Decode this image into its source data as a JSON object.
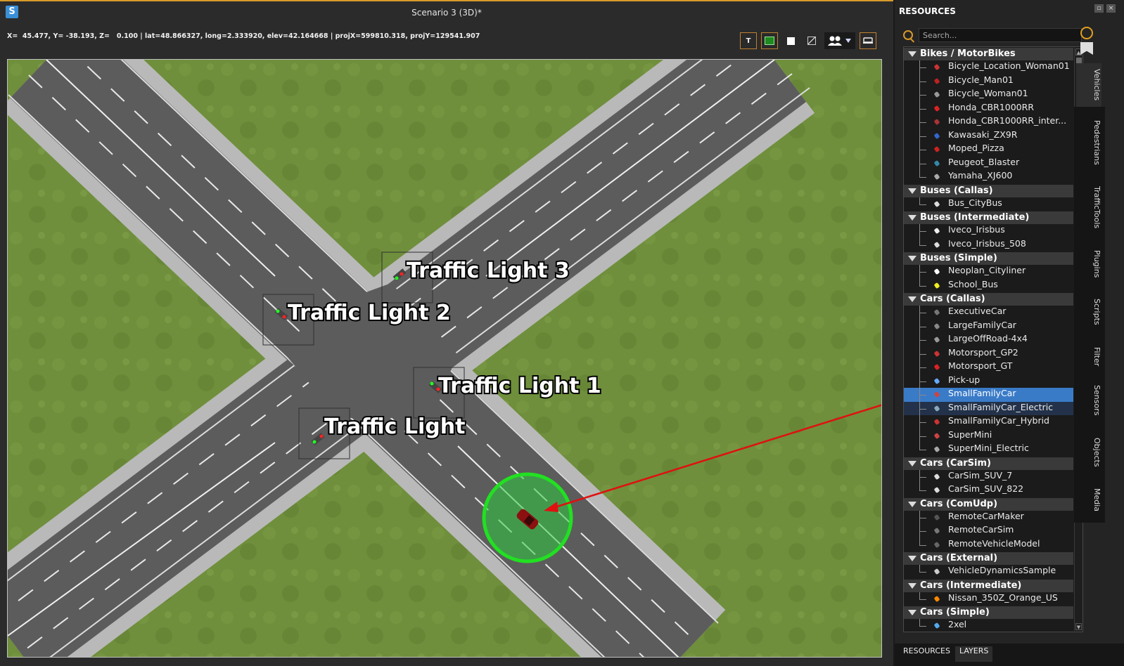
{
  "window": {
    "title": "Scenario 3 (3D)*",
    "logo": "S",
    "coords": "X=  45.477, Y= -38.193, Z=   0.100 | lat=48.866327, long=2.333920, elev=42.164668 | projX=599810.318, projY=129541.907"
  },
  "toolbar": {
    "text_btn": "T",
    "buttons": [
      "text-toggle-icon",
      "grid-toggle-icon",
      "square-icon",
      "no-entry-icon",
      "camera-group-icon",
      "vehicle-icon"
    ]
  },
  "viewport": {
    "traffic_lights": [
      "Traffic Light 3",
      "Traffic Light 2",
      "Traffic Light 1",
      "Traffic Light"
    ],
    "colors": {
      "grass": "#6f8f3c",
      "road": "#5a5a5a",
      "sidewalk": "#b8b8b8",
      "selection": "#22e022",
      "arrow": "#e01010"
    }
  },
  "resources": {
    "title": "RESOURCES",
    "search_placeholder": "Search...",
    "categories": [
      {
        "name": "Bikes / MotorBikes",
        "items": [
          "Bicycle_Location_Woman01",
          "Bicycle_Man01",
          "Bicycle_Woman01",
          "Honda_CBR1000RR",
          "Honda_CBR1000RR_inter...",
          "Kawasaki_ZX9R",
          "Moped_Pizza",
          "Peugeot_Blaster",
          "Yamaha_XJ600"
        ]
      },
      {
        "name": "Buses (Callas)",
        "items": [
          "Bus_CityBus"
        ]
      },
      {
        "name": "Buses (Intermediate)",
        "items": [
          "Iveco_Irisbus",
          "Iveco_Irisbus_508"
        ]
      },
      {
        "name": "Buses (Simple)",
        "items": [
          "Neoplan_Cityliner",
          "School_Bus"
        ]
      },
      {
        "name": "Cars (Callas)",
        "items": [
          "ExecutiveCar",
          "LargeFamilyCar",
          "LargeOffRoad-4x4",
          "Motorsport_GP2",
          "Motorsport_GT",
          "Pick-up",
          "SmallFamilyCar",
          "SmallFamilyCar_Electric",
          "SmallFamilyCar_Hybrid",
          "SuperMini",
          "SuperMini_Electric"
        ]
      },
      {
        "name": "Cars (CarSim)",
        "items": [
          "CarSim_SUV_7",
          "CarSim_SUV_822"
        ]
      },
      {
        "name": "Cars (ComUdp)",
        "items": [
          "RemoteCarMaker",
          "RemoteCarSim",
          "RemoteVehicleModel"
        ]
      },
      {
        "name": "Cars (External)",
        "items": [
          "VehicleDynamicsSample"
        ]
      },
      {
        "name": "Cars (Intermediate)",
        "items": [
          "Nissan_350Z_Orange_US"
        ]
      },
      {
        "name": "Cars (Simple)",
        "items": [
          "2xel"
        ]
      }
    ],
    "selected_item": "SmallFamilyCar",
    "hover_item": "SmallFamilyCar_Electric",
    "side_tabs": [
      "Vehicles",
      "Pedestrians",
      "TrafficTools",
      "Plugins",
      "Scripts",
      "Filter",
      "Sensors",
      "Objects",
      "Media"
    ],
    "bottom_tabs": [
      "RESOURCES",
      "LAYERS"
    ]
  }
}
